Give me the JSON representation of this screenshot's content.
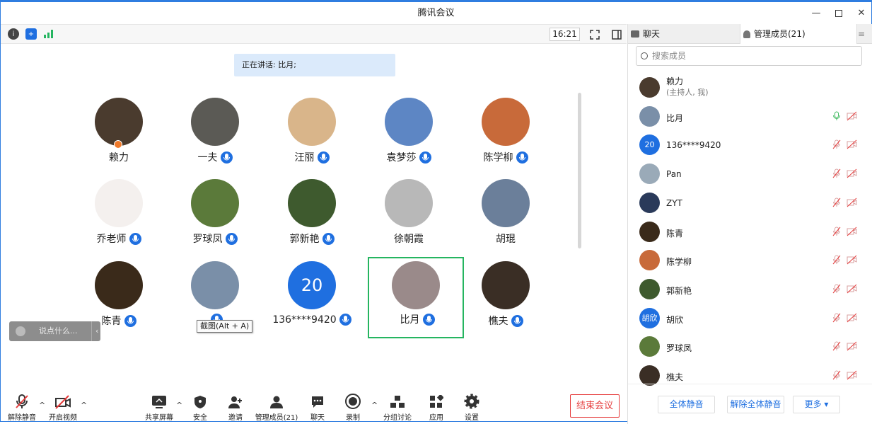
{
  "window": {
    "title": "腾讯会议"
  },
  "topbar": {
    "time": "16:21"
  },
  "speaking": {
    "text": "正在讲话: 比月;"
  },
  "grid": {
    "tiles": [
      {
        "name": "赖力",
        "mic": false,
        "host": true
      },
      {
        "name": "一夫",
        "mic": true
      },
      {
        "name": "汪丽",
        "mic": true
      },
      {
        "name": "袁梦莎",
        "mic": true
      },
      {
        "name": "陈学柳",
        "mic": true
      },
      {
        "name": "乔老师",
        "mic": true
      },
      {
        "name": "罗球凤",
        "mic": true
      },
      {
        "name": "郭新艳",
        "mic": true
      },
      {
        "name": "徐朝霞",
        "mic": false
      },
      {
        "name": "胡琨",
        "mic": false
      },
      {
        "name": "陈青",
        "mic": true
      },
      {
        "name": "",
        "mic": true
      },
      {
        "name": "136****9420",
        "mic": true,
        "avatar_text": "20"
      },
      {
        "name": "比月",
        "mic": true,
        "active": true
      },
      {
        "name": "樵夫",
        "mic": true
      }
    ]
  },
  "chat_box": {
    "placeholder": "说点什么..."
  },
  "tooltip": {
    "text": "截图(Alt + A)"
  },
  "toolbar": {
    "mute": "解除静音",
    "video": "开启视频",
    "share": "共享屏幕",
    "security": "安全",
    "invite": "邀请",
    "manage": "管理成员(21)",
    "chat": "聊天",
    "record": "录制",
    "breakout": "分组讨论",
    "apps": "应用",
    "settings": "设置",
    "end": "结束会议"
  },
  "right_panel": {
    "tab_chat": "聊天",
    "tab_members": "管理成员(21)",
    "search_placeholder": "搜索成员",
    "members": [
      {
        "name": "赖力",
        "sub": "(主持人, 我)"
      },
      {
        "name": "比月",
        "mic": "on"
      },
      {
        "name": "136****9420",
        "avatar_text": "20"
      },
      {
        "name": "Pan"
      },
      {
        "name": "ZYT"
      },
      {
        "name": "陈青"
      },
      {
        "name": "陈学柳"
      },
      {
        "name": "郭新艳"
      },
      {
        "name": "胡欣",
        "avatar_text": "胡欣"
      },
      {
        "name": "罗球凤"
      },
      {
        "name": "樵夫"
      }
    ],
    "btn_mute_all": "全体静音",
    "btn_unmute_all": "解除全体静音",
    "btn_more": "更多"
  },
  "colors": {
    "accent": "#1f6fe0",
    "highlight": "#25b560",
    "end": "#e53b3b"
  }
}
